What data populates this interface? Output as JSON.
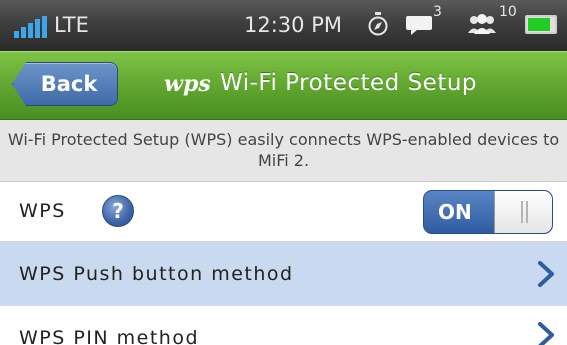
{
  "status_bar": {
    "network": "LTE",
    "time": "12:30 PM",
    "message_count": "3",
    "user_count": "10",
    "battery_level": 0.85,
    "battery_color": "#22cc22",
    "icons": [
      "signal-bars-icon",
      "compass-icon",
      "message-icon",
      "users-icon",
      "battery-icon"
    ]
  },
  "title_bar": {
    "back_label": "Back",
    "logo_text": "wps",
    "title": "Wi-Fi Protected Setup",
    "accent_color": "#5ea42e"
  },
  "description": {
    "text": "Wi-Fi Protected Setup (WPS) easily connects WPS-enabled devices to MiFi 2."
  },
  "settings": {
    "wps": {
      "label": "WPS",
      "help_icon": "?",
      "toggle_state": "ON"
    },
    "push_button": {
      "label": "WPS Push button method"
    },
    "pin": {
      "label": "WPS PIN method"
    }
  }
}
